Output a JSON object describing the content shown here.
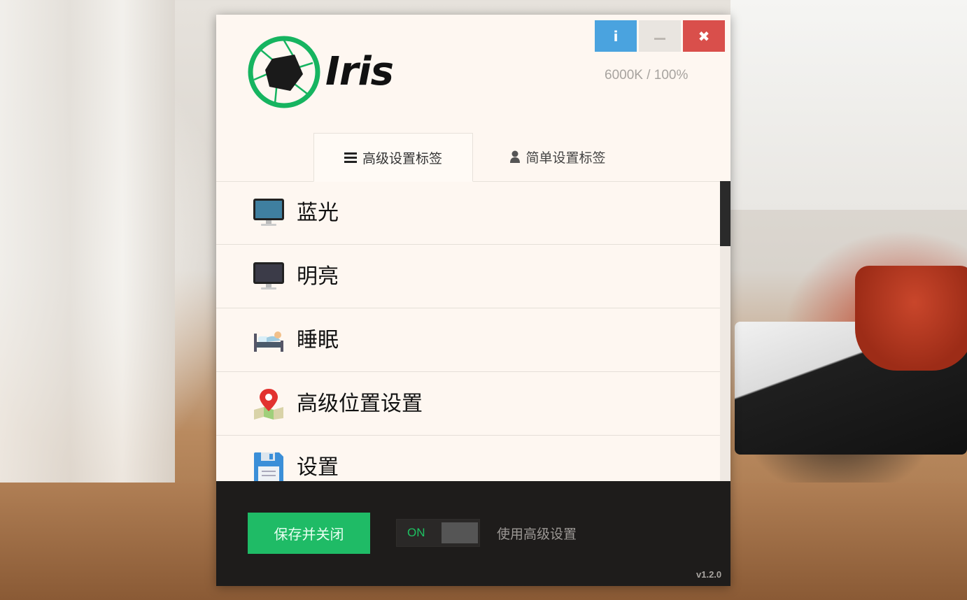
{
  "app": {
    "logo_text": "Iris",
    "status": "6000K / 100%",
    "version": "v1.2.0"
  },
  "window_buttons": {
    "info_icon": "info-icon",
    "minimize_icon": "minimize-icon",
    "close_icon": "close-icon"
  },
  "tabs": [
    {
      "label": "高级设置标签",
      "icon": "menu-icon",
      "active": true
    },
    {
      "label": "简单设置标签",
      "icon": "user-icon",
      "active": false
    }
  ],
  "menu": {
    "items": [
      {
        "label": "蓝光",
        "icon": "monitor-blue-icon"
      },
      {
        "label": "明亮",
        "icon": "monitor-dark-icon"
      },
      {
        "label": "睡眠",
        "icon": "bed-icon"
      },
      {
        "label": "高级位置设置",
        "icon": "map-pin-icon"
      },
      {
        "label": "设置",
        "icon": "floppy-disk-icon"
      }
    ]
  },
  "footer": {
    "save_label": "保存并关闭",
    "toggle_state": "ON",
    "toggle_label": "使用高级设置"
  },
  "colors": {
    "accent_green": "#1fbb66",
    "info_blue": "#4aa3df",
    "close_red": "#d94f4b",
    "footer_bg": "#1e1c1b",
    "panel_bg": "#fef7f1"
  }
}
